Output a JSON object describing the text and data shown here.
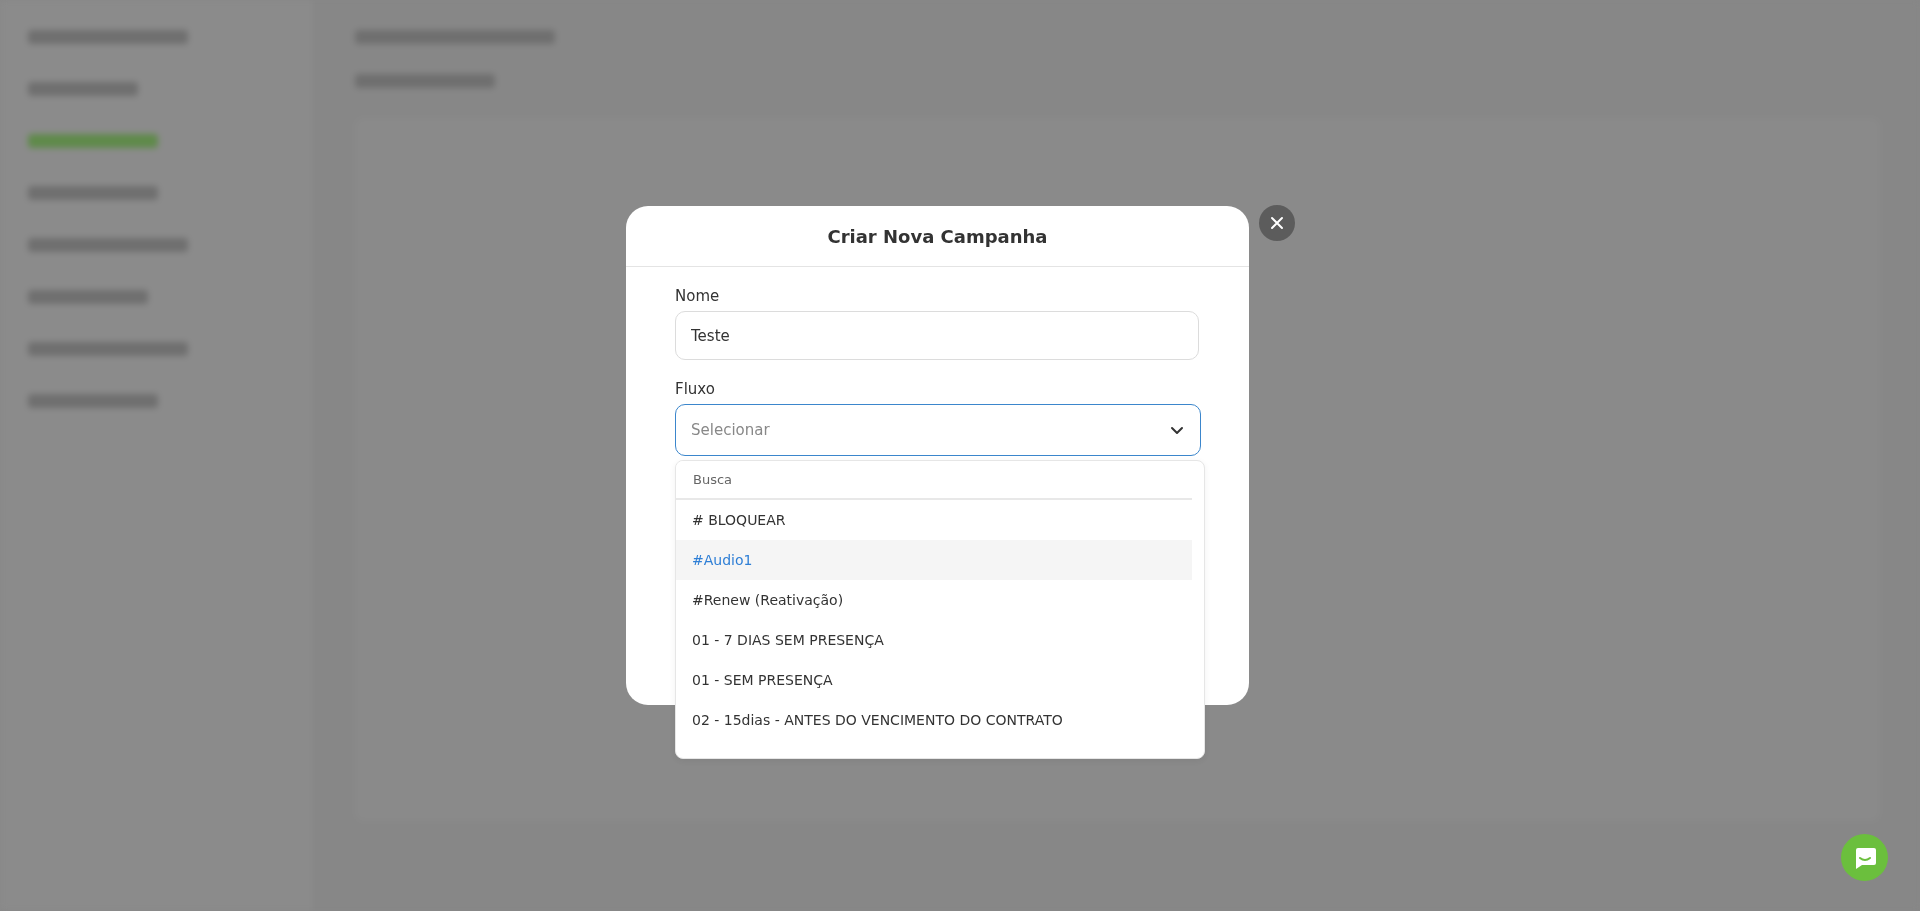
{
  "dialog": {
    "title": "Criar Nova Campanha",
    "fields": [
      {
        "kind": "text",
        "label": "Nome",
        "value": "Teste"
      },
      {
        "kind": "select",
        "label": "Fluxo",
        "placeholder": "Selecionar",
        "expanded": true,
        "search": {
          "placeholder": "Busca"
        },
        "options": [
          {
            "label": "# BLOQUEAR",
            "highlighted": false
          },
          {
            "label": "#Audio1",
            "highlighted": true
          },
          {
            "label": "#Renew (Reativação)",
            "highlighted": false
          },
          {
            "label": "01 - 7 DIAS SEM PRESENÇA",
            "highlighted": false
          },
          {
            "label": "01 - SEM PRESENÇA",
            "highlighted": false
          },
          {
            "label": "02 - 15dias - ANTES DO VENCIMENTO DO CONTRATO",
            "highlighted": false
          }
        ]
      }
    ]
  }
}
